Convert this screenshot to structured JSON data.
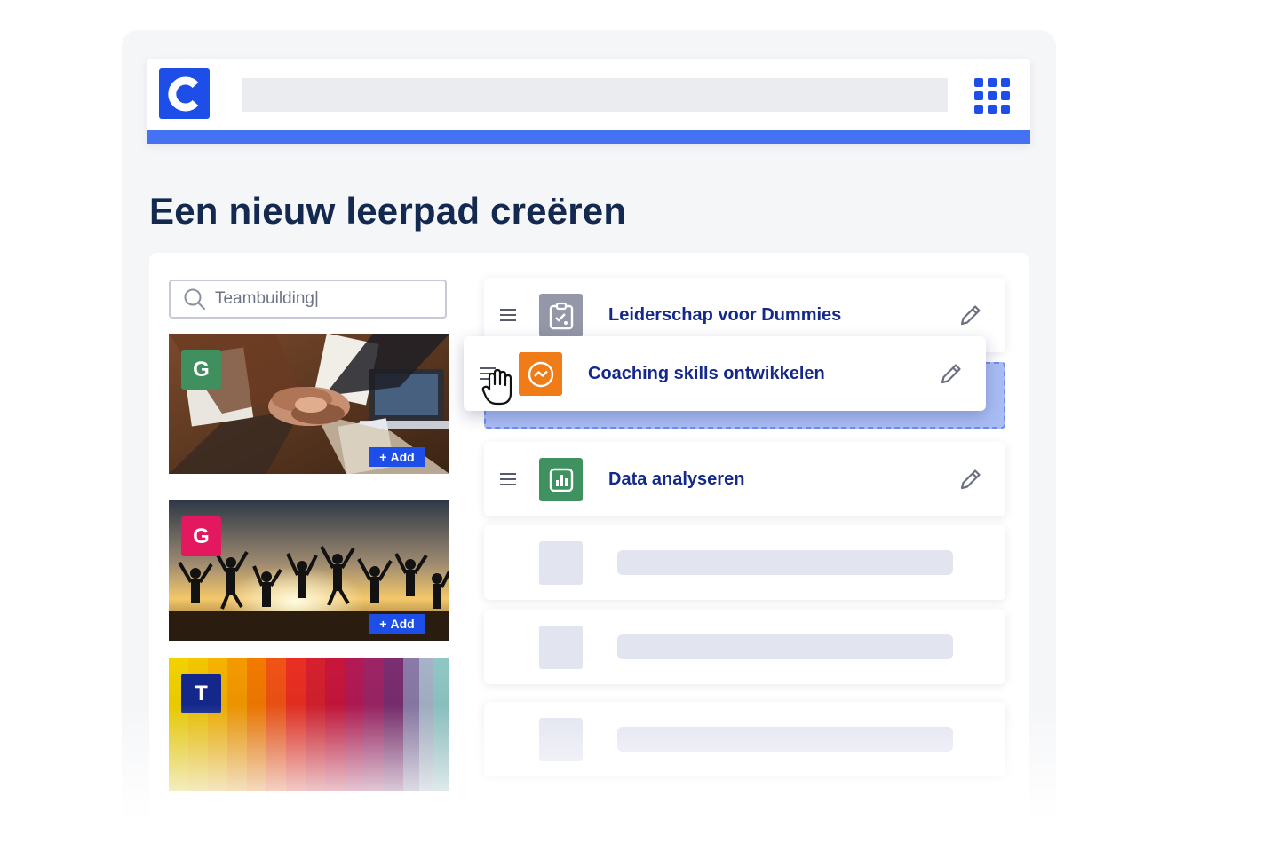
{
  "page": {
    "title": "Een nieuw leerpad creëren"
  },
  "colors": {
    "brand": "#1d4fe8",
    "accent_bar": "#4472f2",
    "title": "#14294f",
    "item_label": "#14298a",
    "badge_green": "#3f8f5f",
    "badge_pink": "#e3185e",
    "badge_navy": "#13288a",
    "icon_gray": "#9497a7",
    "icon_orange": "#ef7c16",
    "icon_green": "#3f9160"
  },
  "header": {
    "logo_letter": "C",
    "apps_icon": "grid-icon"
  },
  "library": {
    "search": {
      "value": "Teambuilding|",
      "icon": "search-icon"
    },
    "cards": [
      {
        "badge": "G",
        "add_label": "Add",
        "add_symbol": "+"
      },
      {
        "badge": "G",
        "add_label": "Add",
        "add_symbol": "+"
      },
      {
        "badge": "T"
      }
    ]
  },
  "path_items": [
    {
      "label": "Leiderschap voor Dummies",
      "icon": "assignment-icon"
    },
    {
      "label": "Coaching skills ontwikkelen",
      "icon": "coaching-icon",
      "state": "dragging"
    },
    {
      "label": "Data analyseren",
      "icon": "chart-icon"
    }
  ],
  "placeholders": 3
}
